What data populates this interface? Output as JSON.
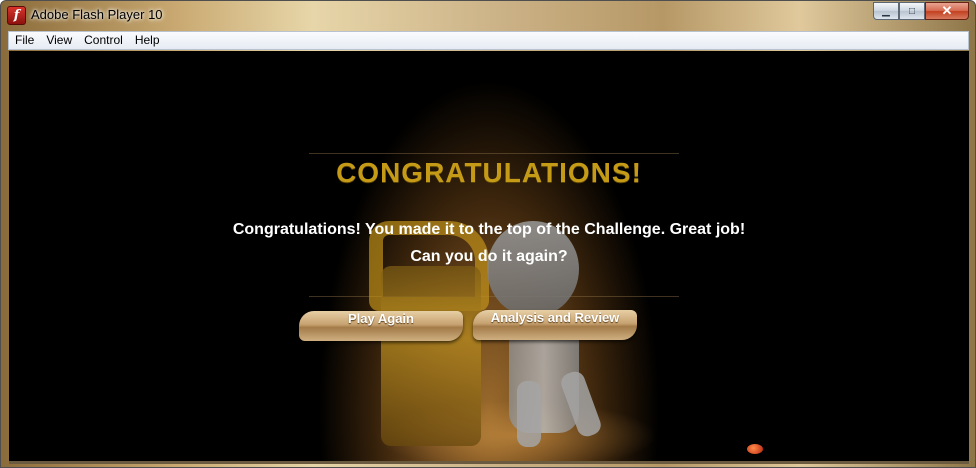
{
  "window": {
    "title": "Adobe Flash Player 10",
    "app_icon_glyph": "f",
    "controls": {
      "minimize_glyph": "▁",
      "maximize_glyph": "□",
      "close_glyph": "✕"
    }
  },
  "menu": {
    "items": [
      "File",
      "View",
      "Control",
      "Help"
    ]
  },
  "game": {
    "heading": "CONGRATULATIONS!",
    "message_line1": "Congratulations! You made it to the top of the Challenge. Great job!",
    "message_line2": "Can you do it again?",
    "buttons": {
      "play_again": "Play Again",
      "analysis": "Analysis and Review"
    }
  },
  "colors": {
    "heading_gold": "#c49a17",
    "stage_background": "#000000",
    "button_tan": "#c7a271"
  }
}
